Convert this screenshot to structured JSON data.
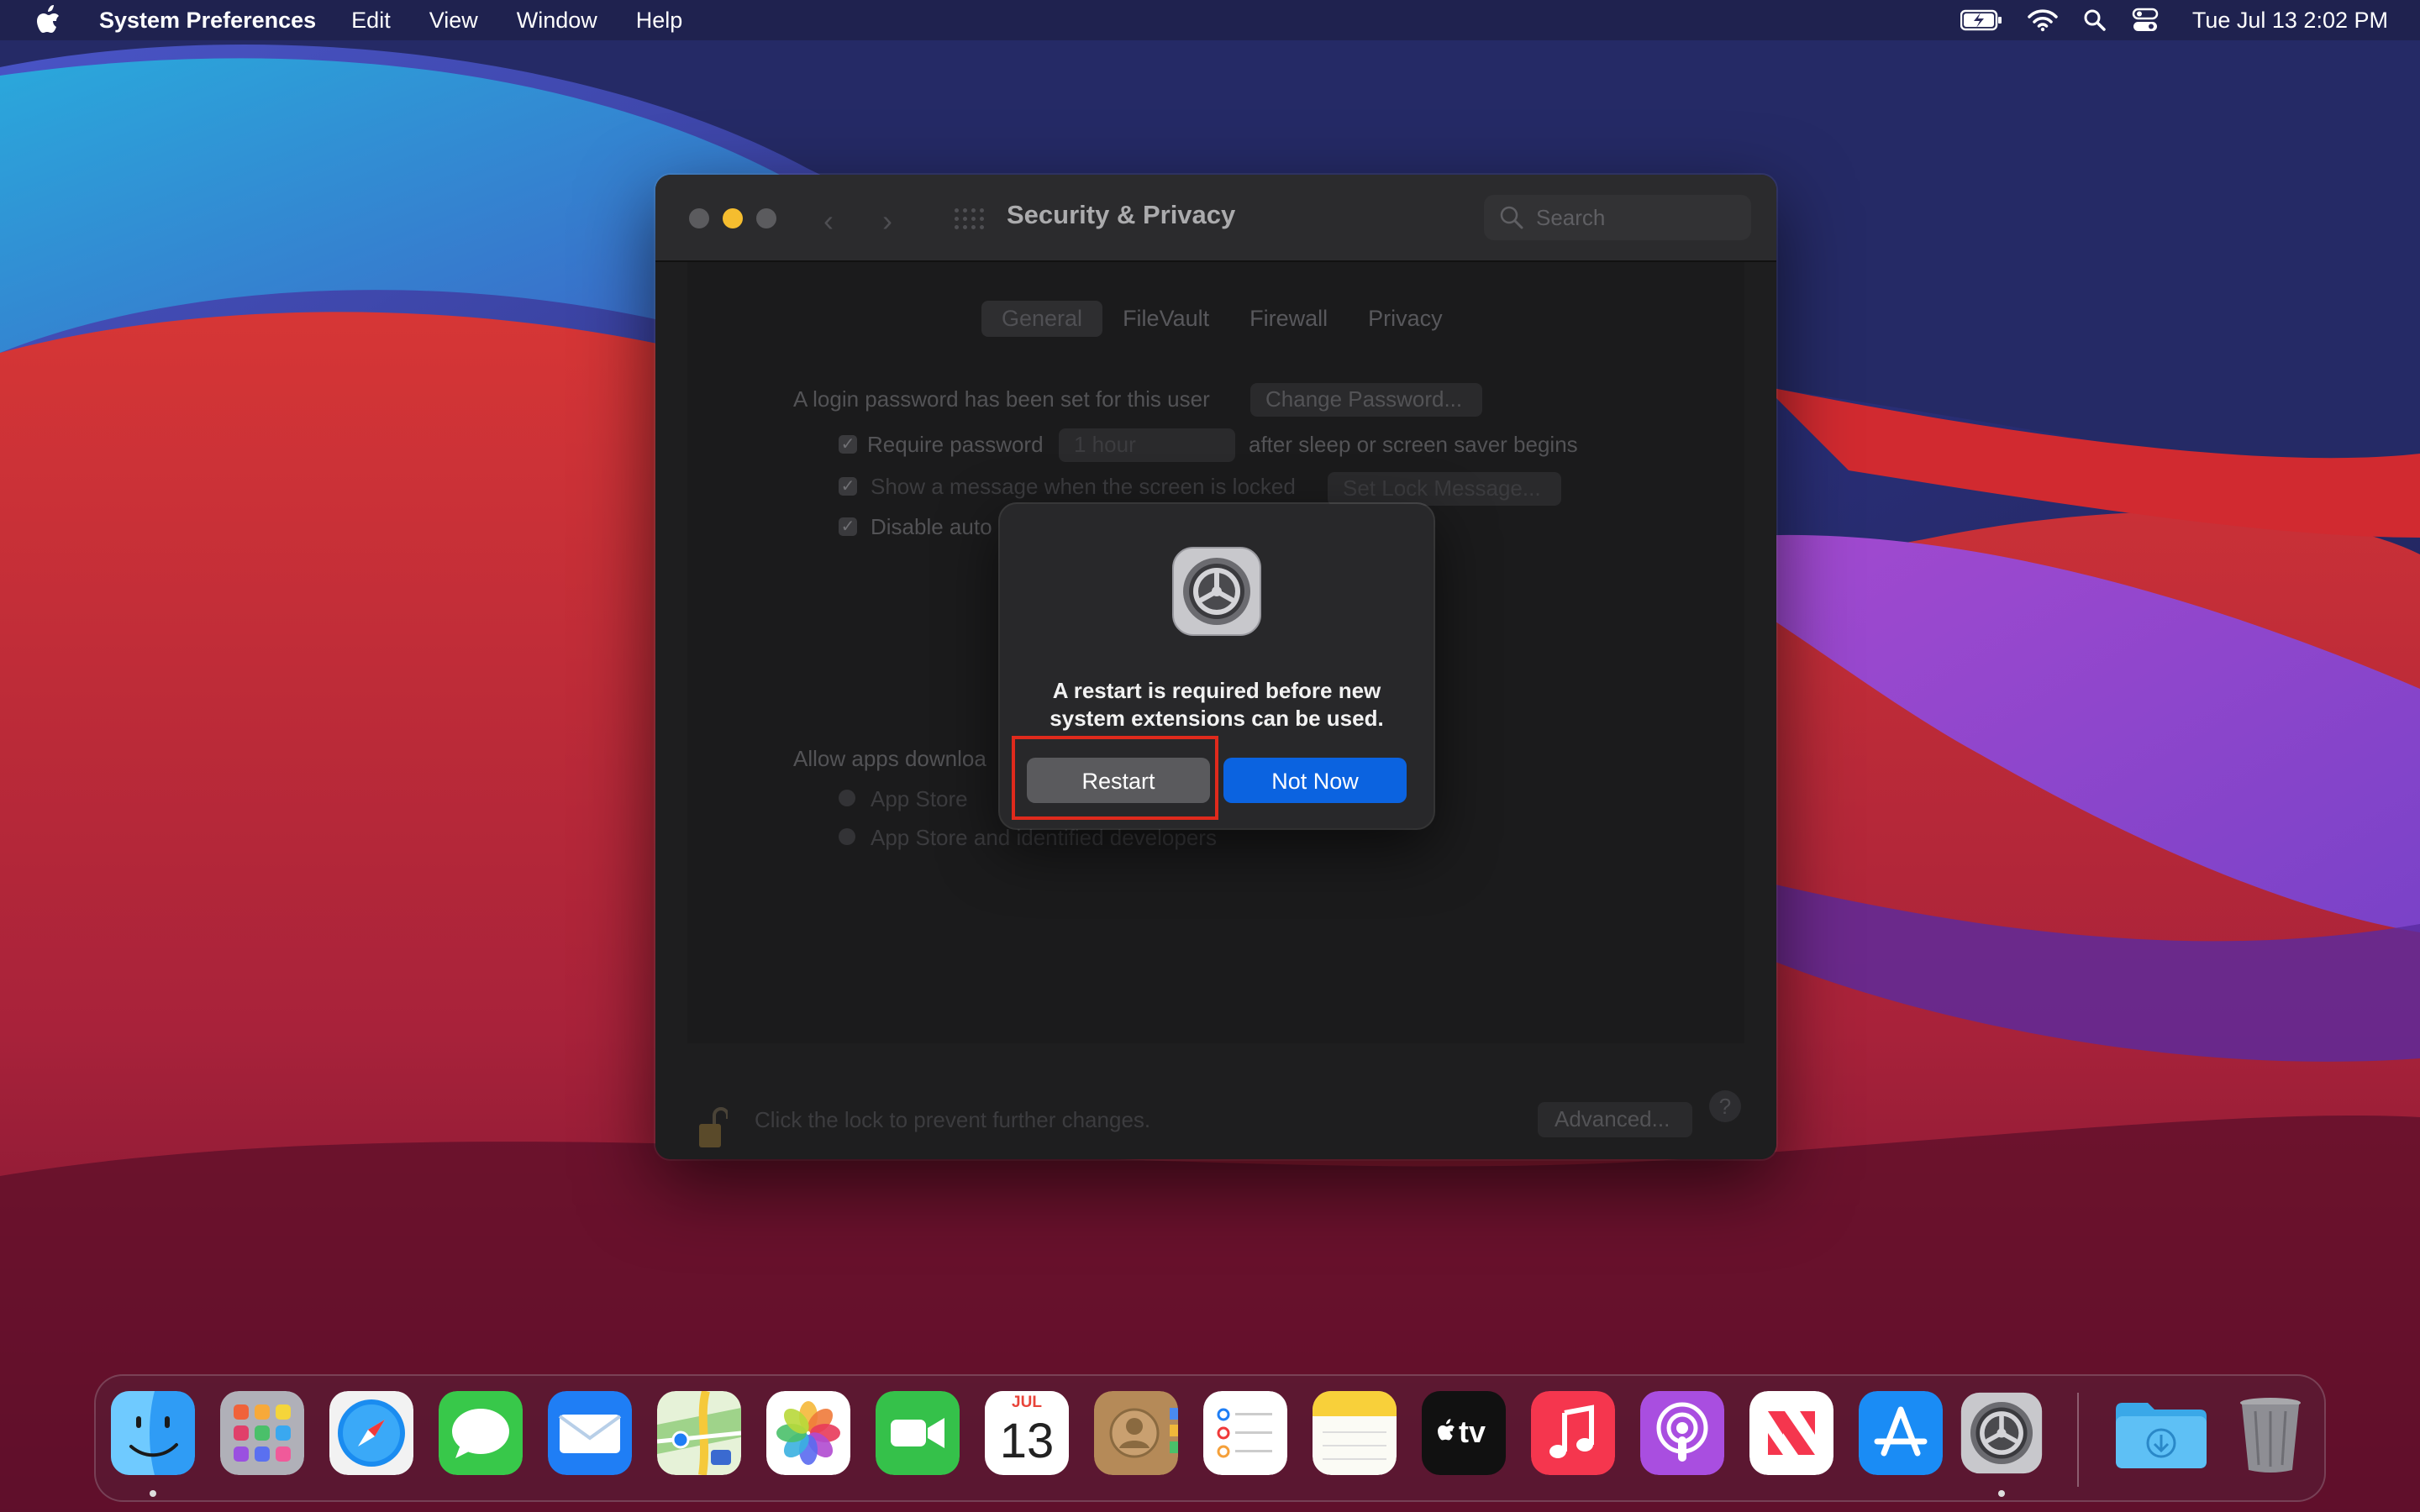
{
  "menubar": {
    "app_name": "System Preferences",
    "items": [
      "Edit",
      "View",
      "Window",
      "Help"
    ],
    "clock": "Tue Jul 13  2:02 PM"
  },
  "window": {
    "title": "Security & Privacy",
    "search_placeholder": "Search",
    "tabs": [
      "General",
      "FileVault",
      "Firewall",
      "Privacy"
    ],
    "selected_tab": "General",
    "login_password_text": "A login password has been set for this user",
    "change_password_label": "Change Password...",
    "require_password_label": "Require password",
    "require_password_value": "1 hour",
    "require_password_suffix": "after sleep or screen saver begins",
    "show_message_label": "Show a message when the screen is locked",
    "set_lock_message_label": "Set Lock Message...",
    "disable_auto_label": "Disable auto",
    "allow_apps_label": "Allow apps downloa",
    "radio_app_store": "App Store",
    "radio_app_store_dev": "App Store and identified developers",
    "lock_text": "Click the lock to prevent further changes.",
    "advanced_label": "Advanced...",
    "help_label": "?"
  },
  "alert": {
    "message_line1": "A restart is required before new",
    "message_line2": "system extensions can be used.",
    "restart_label": "Restart",
    "not_now_label": "Not Now"
  },
  "dock": {
    "calendar_month": "JUL",
    "calendar_day": "13",
    "tv_label": "tv",
    "items": [
      "finder-icon",
      "launchpad-icon",
      "safari-icon",
      "messages-icon",
      "mail-icon",
      "maps-icon",
      "photos-icon",
      "facetime-icon",
      "calendar-icon",
      "contacts-icon",
      "reminders-icon",
      "notes-icon",
      "apple-tv-icon",
      "music-icon",
      "podcasts-icon",
      "news-icon",
      "app-store-icon",
      "system-preferences-icon",
      "downloads-folder-icon",
      "trash-icon"
    ]
  },
  "colors": {
    "accent_blue": "#0b63e0",
    "highlight_red": "#e02a1c",
    "traffic_yellow": "#f5bd2f"
  }
}
